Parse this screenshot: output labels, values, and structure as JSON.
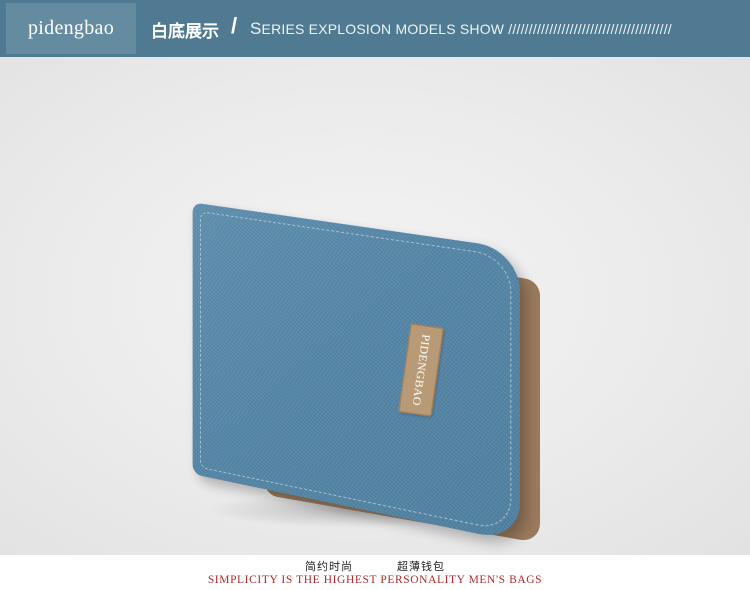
{
  "banner": {
    "brand": "pidengbao",
    "heading_cn": "白底展示",
    "slash": "/",
    "heading_en_initial": "S",
    "heading_en_rest": "ERIES EXPLOSION MODELS SHOW ////////////////////////////////////////"
  },
  "photo": {
    "tag_text": "PIDENGBAO"
  },
  "caption": {
    "cn_left": "简约时尚",
    "cn_right": "超薄钱包",
    "en": "SIMPLICITY IS THE HIGHEST PERSONALITY MEN'S BAGS"
  },
  "colors": {
    "banner": "#4f7a91",
    "brand_box": "#658ba0",
    "wallet_blue": "#5486a6",
    "leather": "#b89a76",
    "caption_red": "#b22a2a"
  }
}
